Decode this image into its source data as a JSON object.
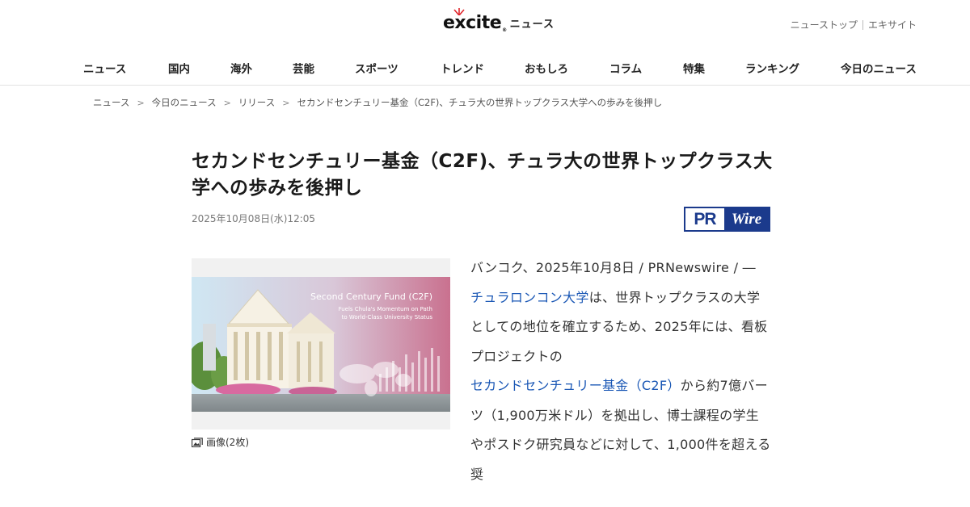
{
  "header": {
    "logo_text": "excite",
    "logo_sub": "ニュース",
    "toplinks": [
      "ニューストップ",
      "エキサイト"
    ]
  },
  "nav": {
    "items": [
      "ニュース",
      "国内",
      "海外",
      "芸能",
      "スポーツ",
      "トレンド",
      "おもしろ",
      "コラム",
      "特集",
      "ランキング",
      "今日のニュース"
    ]
  },
  "breadcrumb": {
    "items": [
      "ニュース",
      "今日のニュース",
      "リリース",
      "セカンドセンチュリー基金（C2F)、チュラ大の世界トップクラス大学への歩みを後押し"
    ],
    "separator": ">"
  },
  "article": {
    "title": "セカンドセンチュリー基金（C2F)、チュラ大の世界トップクラス大学への歩みを後押し",
    "date": "2025年10月08日(水)12:05",
    "source_logo": {
      "pr": "PR",
      "wire": "Wire"
    },
    "image": {
      "overlay_title": "Second Century Fund (C2F)",
      "overlay_line1": "Fuels Chula's Momentum on Path",
      "overlay_line2": "to World-Class University Status"
    },
    "caption": "画像(2枚)",
    "body": {
      "p1": "バンコク、2025年10月8日 / PRNewswire / ― ",
      "link1": "チュラロンコン大学",
      "p2": "は、世界トップクラスの大学としての地位を確立するため、2025年には、看板プロジェクトの",
      "link2": "セカンドセンチュリー基金（C2F）",
      "p3": "から約7億バーツ（1,900万米ドル）を拠出し、博士課程の学生やポスドク研究員などに対して、1,000件を超える奨"
    }
  },
  "colors": {
    "link": "#1a57b5",
    "prwire_blue": "#1b3a8c",
    "logo_red": "#e0262c"
  }
}
